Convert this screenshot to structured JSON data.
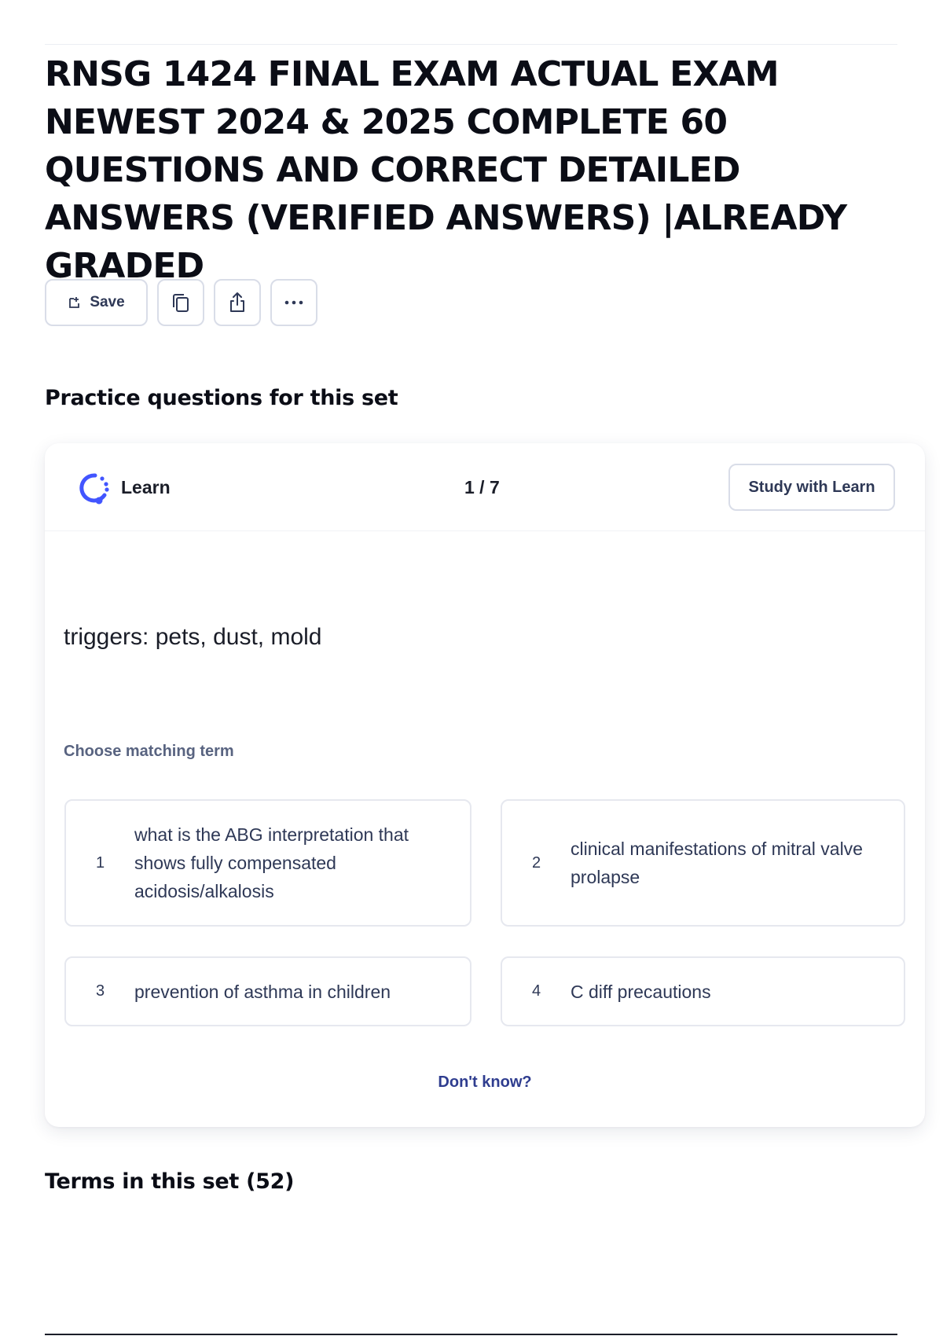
{
  "page": {
    "title": "RNSG 1424 FINAL EXAM ACTUAL EXAM NEWEST 2024 & 2025 COMPLETE 60 QUESTIONS AND CORRECT DETAILED ANSWERS (VERIFIED ANSWERS) |ALREADY GRADED"
  },
  "toolbar": {
    "save_label": "Save",
    "icons": [
      "save-icon",
      "copy-icon",
      "share-icon",
      "more-icon"
    ]
  },
  "practice": {
    "heading": "Practice questions for this set",
    "mode_label": "Learn",
    "progress": "1 / 7",
    "study_button": "Study with Learn",
    "prompt": "triggers: pets, dust, mold",
    "instruction": "Choose matching term",
    "options": [
      {
        "number": "1",
        "text": "what is the ABG interpretation that shows fully compensated acidosis/alkalosis"
      },
      {
        "number": "2",
        "text": "clinical manifestations of mitral valve prolapse"
      },
      {
        "number": "3",
        "text": "prevention of asthma in children"
      },
      {
        "number": "4",
        "text": "C diff precautions"
      }
    ],
    "dont_know": "Don't know?"
  },
  "terms": {
    "heading": "Terms in this set (52)"
  },
  "colors": {
    "accent": "#4255ff",
    "text_primary": "#0b0d16",
    "text_secondary": "#2e3856",
    "text_muted": "#586380",
    "link": "#2f3d8f",
    "border": "#d9dde8"
  }
}
